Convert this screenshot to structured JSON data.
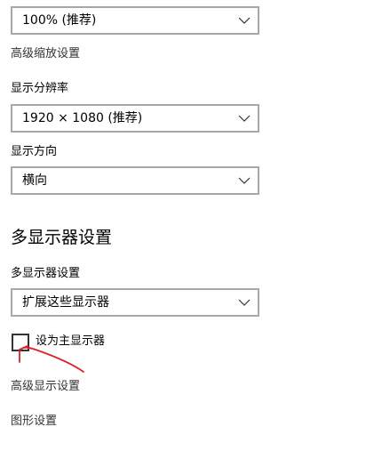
{
  "scale": {
    "dropdown_value": "100% (推荐)",
    "advanced_scaling_link": "高级缩放设置"
  },
  "resolution": {
    "label": "显示分辨率",
    "dropdown_value": "1920 × 1080 (推荐)"
  },
  "orientation": {
    "label": "显示方向",
    "dropdown_value": "横向"
  },
  "multi_display": {
    "heading": "多显示器设置",
    "label": "多显示器设置",
    "dropdown_value": "扩展这些显示器",
    "make_main_label": "设为主显示器",
    "make_main_checked": false
  },
  "links": {
    "advanced_display": "高级显示设置",
    "graphics": "图形设置"
  },
  "icons": {
    "dropdown_arrow": "chevron-down-icon"
  },
  "colors": {
    "annotation_stroke": "#e0202a",
    "dropdown_border": "#a7a7a7"
  }
}
